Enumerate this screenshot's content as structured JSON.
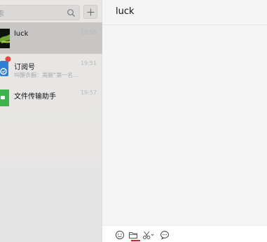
{
  "search": {
    "placeholder": "索"
  },
  "chats": [
    {
      "name": "luck",
      "time": "19:58",
      "preview": ""
    },
    {
      "name": "订阅号",
      "time": "19:51",
      "preview": "叫醒衣橱：美腿“第一名..."
    },
    {
      "name": "文件传输助手",
      "time": "19:57",
      "preview": ""
    }
  ],
  "conversation": {
    "title": "luck"
  },
  "toolbar": {
    "icons": [
      "emoji-icon",
      "folder-icon",
      "scissors-icon",
      "chat-bubble-icon"
    ]
  },
  "colors": {
    "sidebar_bg": "#e6e5e4",
    "active_item_bg": "#c8c6c5",
    "notification_dot": "#e8453c",
    "file_helper_green": "#3bb24b",
    "subscription_blue": "#2f7fd6"
  }
}
